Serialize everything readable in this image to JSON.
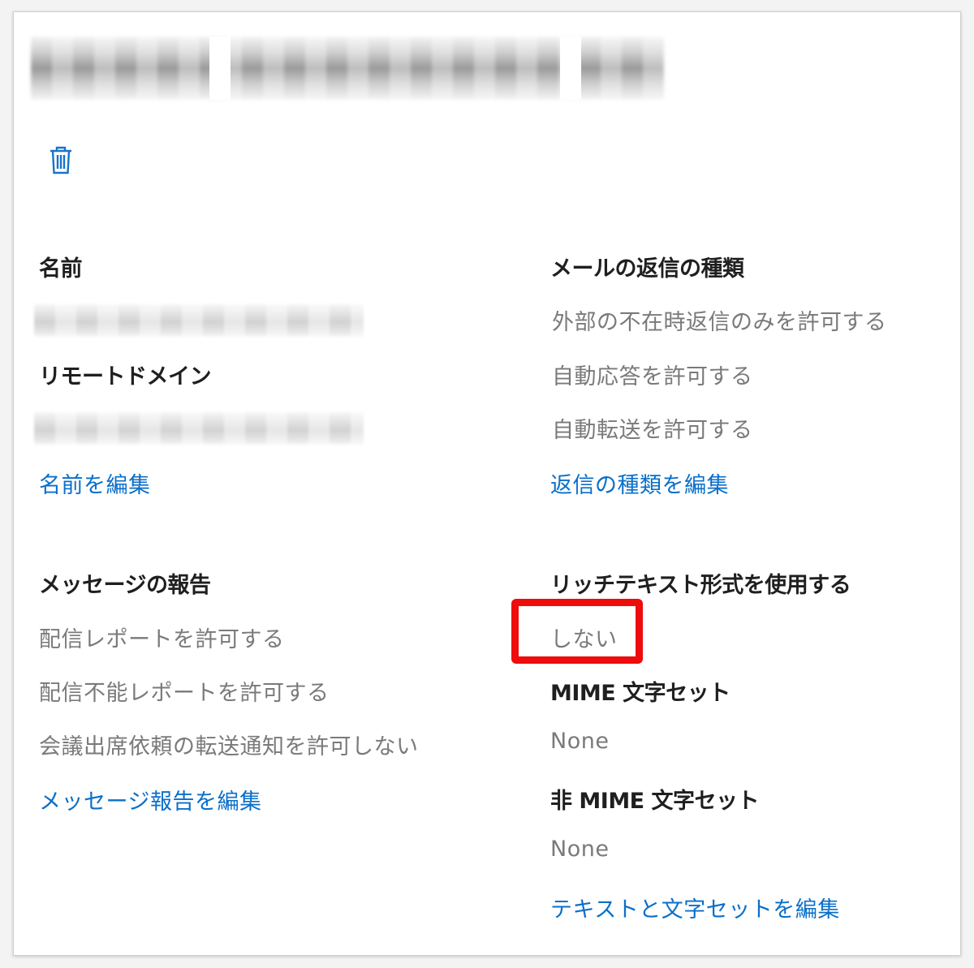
{
  "icons": {
    "delete": "trash-icon"
  },
  "colors": {
    "link": "#0a6fc9",
    "heading": "#1f1f1f",
    "value": "#7a7a7a",
    "highlight": "#ee0c0c"
  },
  "name_section": {
    "heading": "名前"
  },
  "remote_domain_section": {
    "heading": "リモートドメイン"
  },
  "edit_name_link": "名前を編集",
  "message_report_section": {
    "heading": "メッセージの報告",
    "values": [
      "配信レポートを許可する",
      "配信不能レポートを許可する",
      "会議出席依頼の転送通知を許可しない"
    ],
    "edit_link": "メッセージ報告を編集"
  },
  "reply_type_section": {
    "heading": "メールの返信の種類",
    "values": [
      "外部の不在時返信のみを許可する",
      "自動応答を許可する",
      "自動転送を許可する"
    ],
    "edit_link": "返信の種類を編集"
  },
  "rich_text_section": {
    "heading": "リッチテキスト形式を使用する",
    "value": "しない"
  },
  "mime_section": {
    "heading": "MIME 文字セット",
    "value": "None"
  },
  "non_mime_section": {
    "heading": "非 MIME 文字セット",
    "value": "None"
  },
  "edit_text_charset_link": "テキストと文字セットを編集"
}
